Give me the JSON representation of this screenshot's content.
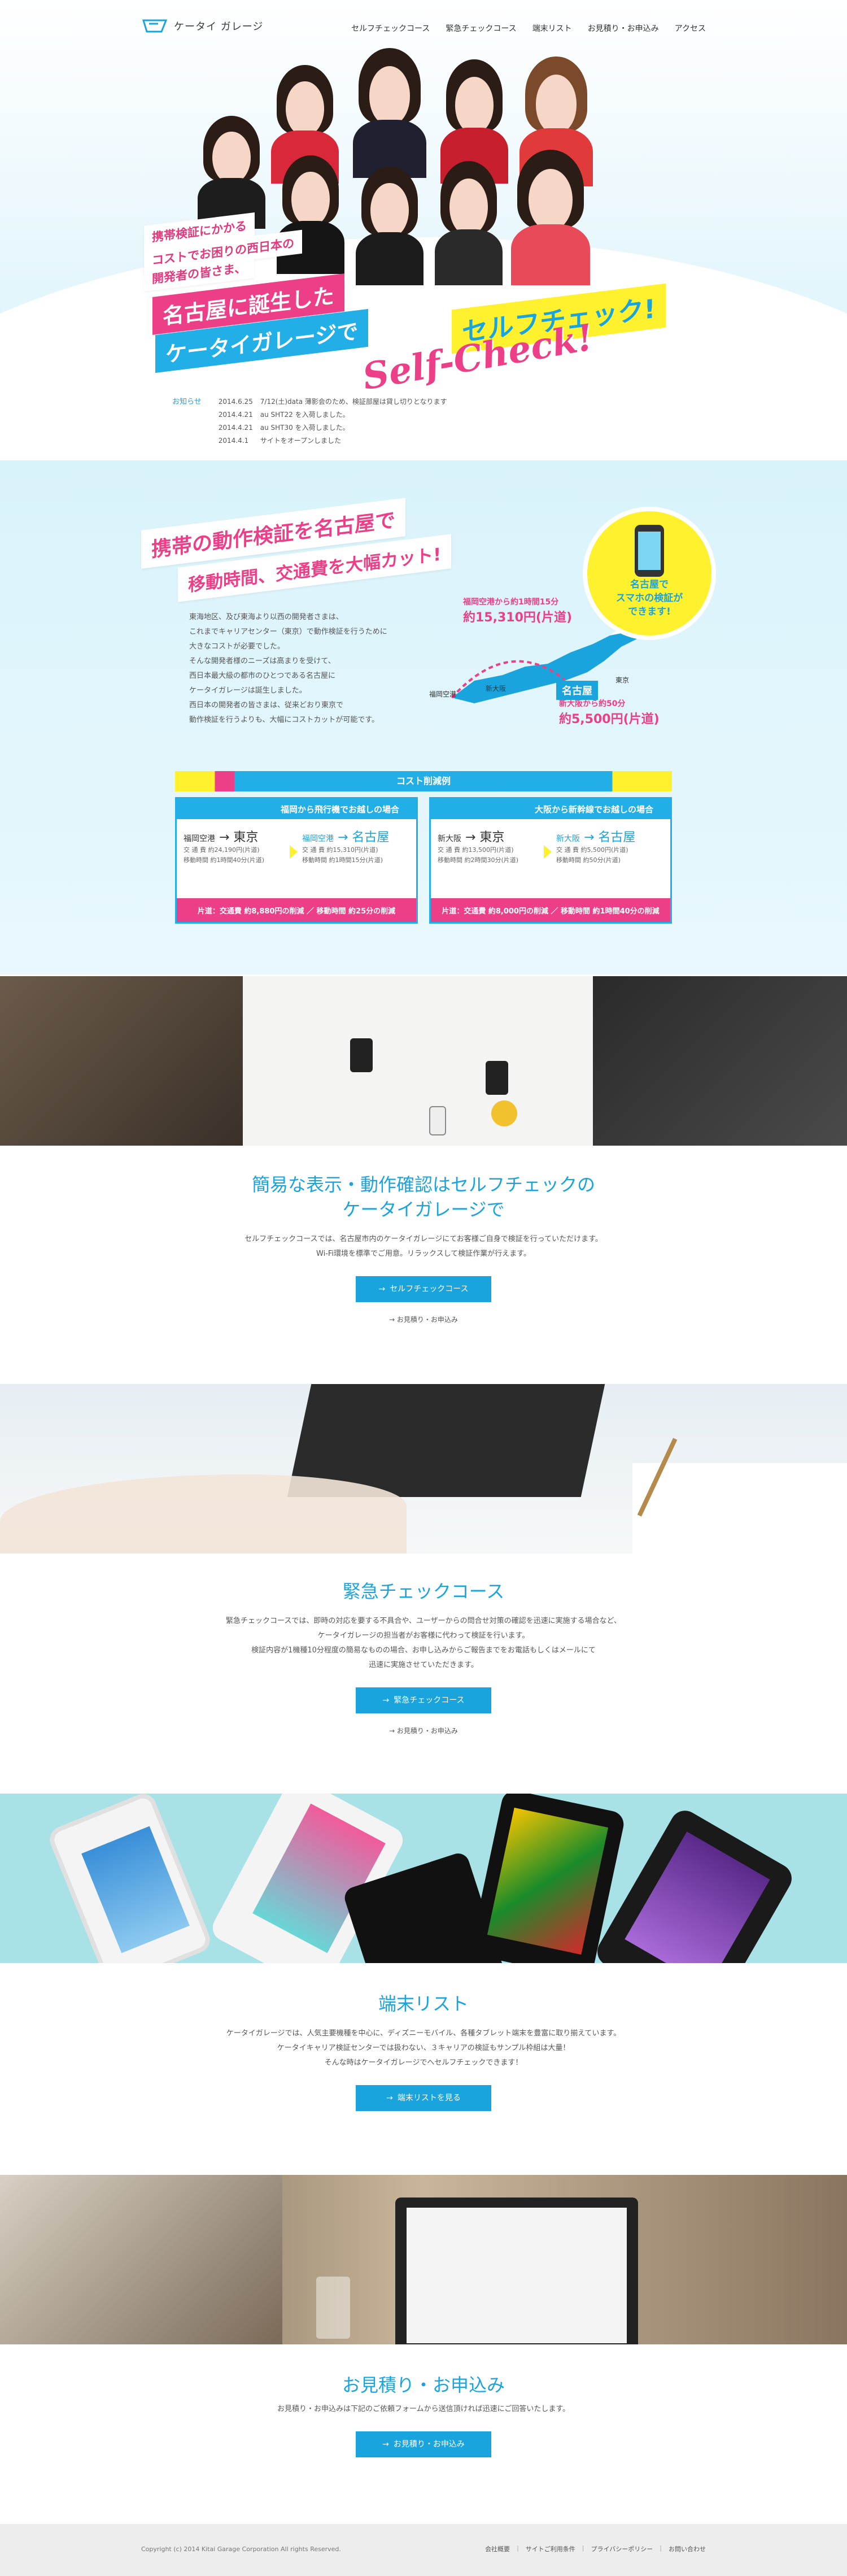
{
  "brand": {
    "name": "ケータイ ガレージ",
    "accent": "#1aa4de",
    "pink": "#ec3f88",
    "yellow": "#fff12e"
  },
  "nav": {
    "items": [
      {
        "label": "セルフチェックコース"
      },
      {
        "label": "緊急チェックコース"
      },
      {
        "label": "端末リスト"
      },
      {
        "label": "お見積り・お申込み"
      },
      {
        "label": "アクセス"
      }
    ]
  },
  "hero": {
    "lead_lines": [
      "携帯検証にかかる",
      "コストでお困りの西日本の",
      "開発者の皆さま、"
    ],
    "tag_1": "名古屋に誕生した",
    "tag_2": "ケータイガレージで",
    "tag_3": "セルフチェック!",
    "script": "Self-Check!"
  },
  "news": {
    "title": "お知らせ",
    "items": [
      {
        "date": "2014.6.25",
        "text": "7/12(土)data 薄影会のため、検証部屋は貸し切りとなります"
      },
      {
        "date": "2014.4.21",
        "text": "au SHT22 を入荷しました。"
      },
      {
        "date": "2014.4.21",
        "text": "au SHT30 を入荷しました。"
      },
      {
        "date": "2014.4.1",
        "text": "サイトをオープンしました"
      }
    ]
  },
  "intro": {
    "heading_1": "携帯の動作検証を名古屋で",
    "heading_2": "移動時間、交通費を大幅カット!",
    "paragraph": [
      "東海地区、及び東海より以西の開発者さまは、",
      "これまでキャリアセンター（東京）で動作検証を行うために",
      "大きなコストが必要でした。",
      "そんな開発者様のニーズは高まりを受けて、",
      "西日本最大級の都市のひとつである名古屋に",
      "ケータイガレージは誕生しました。",
      "西日本の開発者の皆さまは、従来どおり東京で",
      "動作検証を行うよりも、大幅にコストカットが可能です。"
    ],
    "bubble": [
      "名古屋で",
      "スマホの検証が",
      "できます!"
    ],
    "route_air": {
      "label": "福岡空港から約1時間15分",
      "price": "約15,310円(片道)"
    },
    "route_rail": {
      "label": "新大阪から約50分",
      "price": "約5,500円(片道)"
    },
    "cities": {
      "tokyo": "東京",
      "nagoya": "名古屋",
      "osaka": "新大阪",
      "fukuoka": "福岡空港"
    }
  },
  "cost": {
    "title": "コスト削減例",
    "cards": [
      {
        "head": "福岡から飛行機でお越しの場合",
        "from_a": "福岡空港",
        "to_a": "東京",
        "fare_a": "交 通 費 約24,190円(片道)",
        "time_a": "移動時間 約1時間40分(片道)",
        "from_b": "福岡空港",
        "to_b": "名古屋",
        "fare_b": "交 通 費 約15,310円(片道)",
        "time_b": "移動時間 約1時間15分(片道)",
        "foot": "片道：交通費 約8,880円の削減 ／ 移動時間 約25分の削減"
      },
      {
        "head": "大阪から新幹線でお越しの場合",
        "from_a": "新大阪",
        "to_a": "東京",
        "fare_a": "交 通 費 約13,500円(片道)",
        "time_a": "移動時間 約2時間30分(片道)",
        "from_b": "新大阪",
        "to_b": "名古屋",
        "fare_b": "交 通 費 約5,500円(片道)",
        "time_b": "移動時間 約50分(片道)",
        "foot": "片道：交通費 約8,000円の削減 ／ 移動時間 約1時間40分の削減"
      }
    ]
  },
  "self_check": {
    "title_1": "簡易な表示・動作確認はセルフチェックの",
    "title_2": "ケータイガレージで",
    "desc_1": "セルフチェックコースでは、名古屋市内のケータイガレージにてお客様ご自身で検証を行っていただけます。",
    "desc_2": "Wi-Fi環境を標準でご用意。リラックスして検証作業が行えます。",
    "button": "セルフチェックコース",
    "link": "お見積り・お申込み"
  },
  "urgent": {
    "title": "緊急チェックコース",
    "desc_1": "緊急チェックコースでは、即時の対応を要する不具合や、ユーザーからの問合せ対策の確認を迅速に実施する場合など、",
    "desc_2": "ケータイガレージの担当者がお客様に代わって検証を行います。",
    "desc_3": "検証内容が1機種10分程度の簡易なものの場合、お申し込みからご報告までをお電話もしくはメールにて",
    "desc_4": "迅速に実施させていただきます。",
    "button": "緊急チェックコース",
    "link": "お見積り・お申込み"
  },
  "devices": {
    "title": "端末リスト",
    "desc_1": "ケータイガレージでは、人気主要機種を中心に、ディズニーモバイル、各種タブレット端末を豊富に取り揃えています。",
    "desc_2": "ケータイキャリア検証センターでは扱わない、３キャリアの検証もサンプル枠組は大量！",
    "desc_3": "そんな時はケータイガレージでへセルフチェックできます！",
    "button": "端末リストを見る"
  },
  "estimate": {
    "title": "お見積り・お申込み",
    "desc": "お見積り・お申込みは下記のご依頼フォームから送信頂ければ迅速にご回答いたします。",
    "button": "お見積り・お申込み"
  },
  "footer": {
    "copyright": "Copyright (c) 2014 Kitai Garage Corporation All rights Reserved.",
    "links": [
      "会社概要",
      "サイトご利用条件",
      "プライバシーポリシー",
      "お問い合わせ"
    ]
  }
}
